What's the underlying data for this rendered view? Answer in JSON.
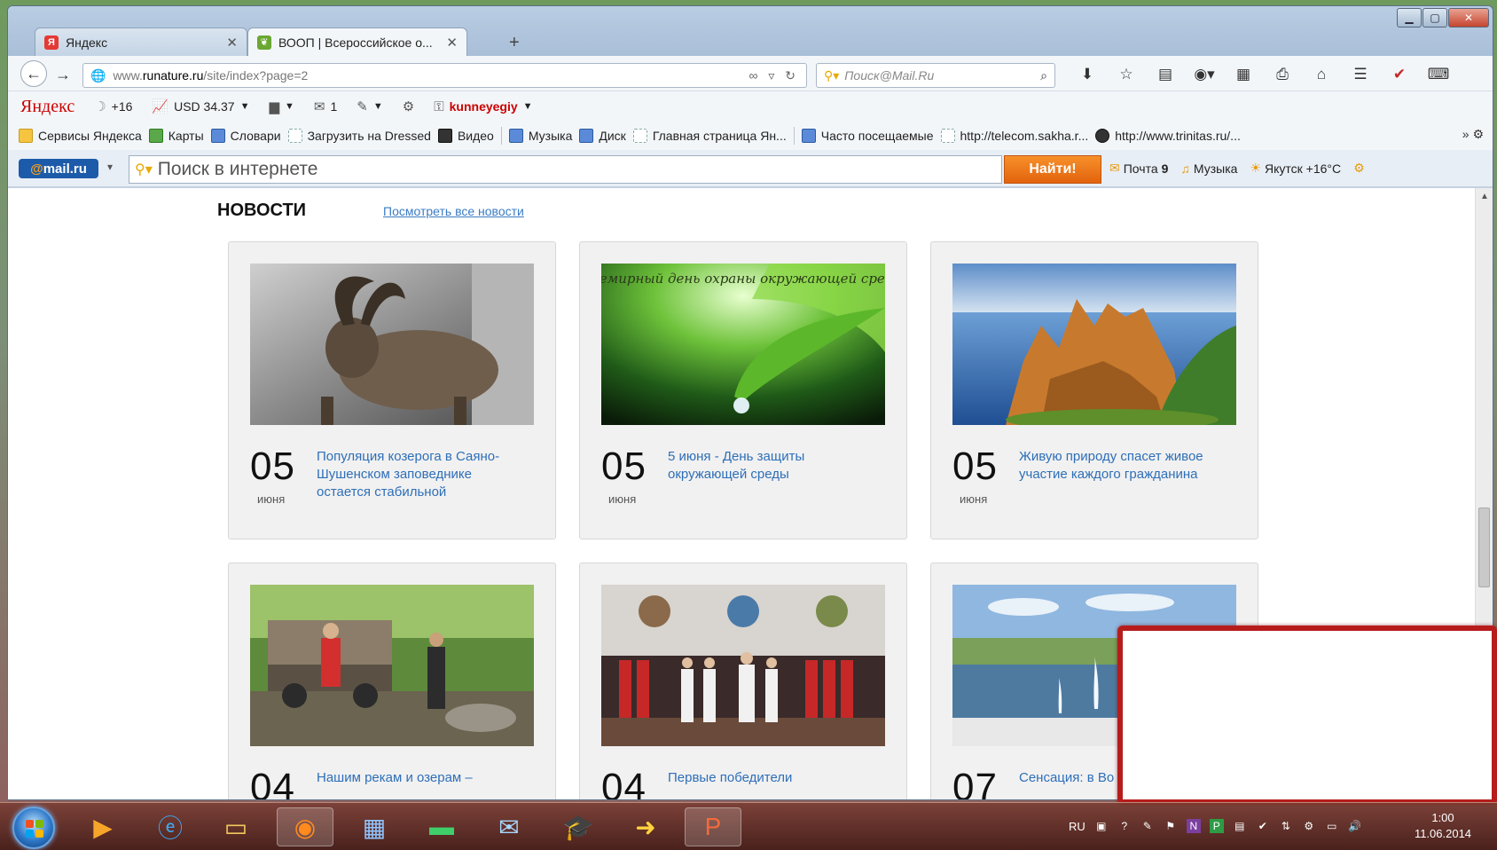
{
  "tabs": [
    {
      "title": "Яндекс",
      "favicon": "yandex-icon"
    },
    {
      "title": "ВООП | Всероссийское о...",
      "favicon": "leaf-icon"
    }
  ],
  "window_controls": [
    "minimize-icon",
    "maximize-icon",
    "close-icon"
  ],
  "nav": {
    "url_prefix": "www.",
    "url_host": "runature.ru",
    "url_path": "/site/index?page=2",
    "search_placeholder": "Поиск@Mail.Ru"
  },
  "yandex_bar": {
    "logo": "Яндекс",
    "weather": "+16",
    "currency": "USD 34.37",
    "mail_count": "1",
    "username": "kunneyegiy"
  },
  "bookmarks": [
    {
      "label": "Сервисы Яндекса",
      "icon": "folder"
    },
    {
      "label": "Карты",
      "icon": "map"
    },
    {
      "label": "Словари",
      "icon": "dictionary"
    },
    {
      "label": "Загрузить на Dressed",
      "icon": "page"
    },
    {
      "label": "Видео",
      "icon": "video"
    },
    {
      "label": "Музыка",
      "icon": "music"
    },
    {
      "label": "Диск",
      "icon": "disk"
    },
    {
      "label": "Главная страница Ян...",
      "icon": "page"
    },
    {
      "label": "Часто посещаемые",
      "icon": "star"
    },
    {
      "label": "http://telecom.sakha.r...",
      "icon": "page"
    },
    {
      "label": "http://www.trinitas.ru/...",
      "icon": "globe"
    }
  ],
  "mailru_bar": {
    "logo_at": "@",
    "logo_text": "mail.ru",
    "search_placeholder": "Поиск в интернете",
    "find_button": "Найти!",
    "mail_label": "Почта",
    "mail_count": "9",
    "music_label": "Музыка",
    "weather_label": "Якутск +16°C"
  },
  "news": {
    "title": "НОВОСТИ",
    "all_link": "Посмотреть все новости",
    "items": [
      {
        "day": "05",
        "month": "июня",
        "headline": "Популяция козерога в Саяно-Шушенском заповеднике остается стабильной",
        "image": "ibex-photo"
      },
      {
        "day": "05",
        "month": "июня",
        "headline": "5 июня - День защиты окружающей среды",
        "image": "leaf-drop-photo",
        "image_caption": "Всемирный день охраны окружающей среды"
      },
      {
        "day": "05",
        "month": "июня",
        "headline": "Живую природу спасет живое участие каждого гражданина",
        "image": "rock-pillars-photo"
      },
      {
        "day": "04",
        "month": "",
        "headline": "Нашим рекам и озерам –",
        "image": "cleanup-photo"
      },
      {
        "day": "04",
        "month": "",
        "headline": "Первые победители",
        "image": "stage-photo"
      },
      {
        "day": "07",
        "month": "",
        "headline": "Сенсация: в Во",
        "image": "fountain-photo"
      }
    ]
  },
  "taskbar": {
    "apps": [
      "media-player-icon",
      "internet-explorer-icon",
      "file-explorer-icon",
      "firefox-icon",
      "calculator-icon",
      "money-icon",
      "certificate-icon",
      "graduate-icon",
      "arrow-icon",
      "powerpoint-icon"
    ],
    "tray_lang": "RU",
    "time": "1:00",
    "date": "11.06.2014"
  },
  "colors": {
    "link": "#2e6fb8",
    "find_button": "#f08020",
    "highlight_border": "#b71c1c"
  }
}
